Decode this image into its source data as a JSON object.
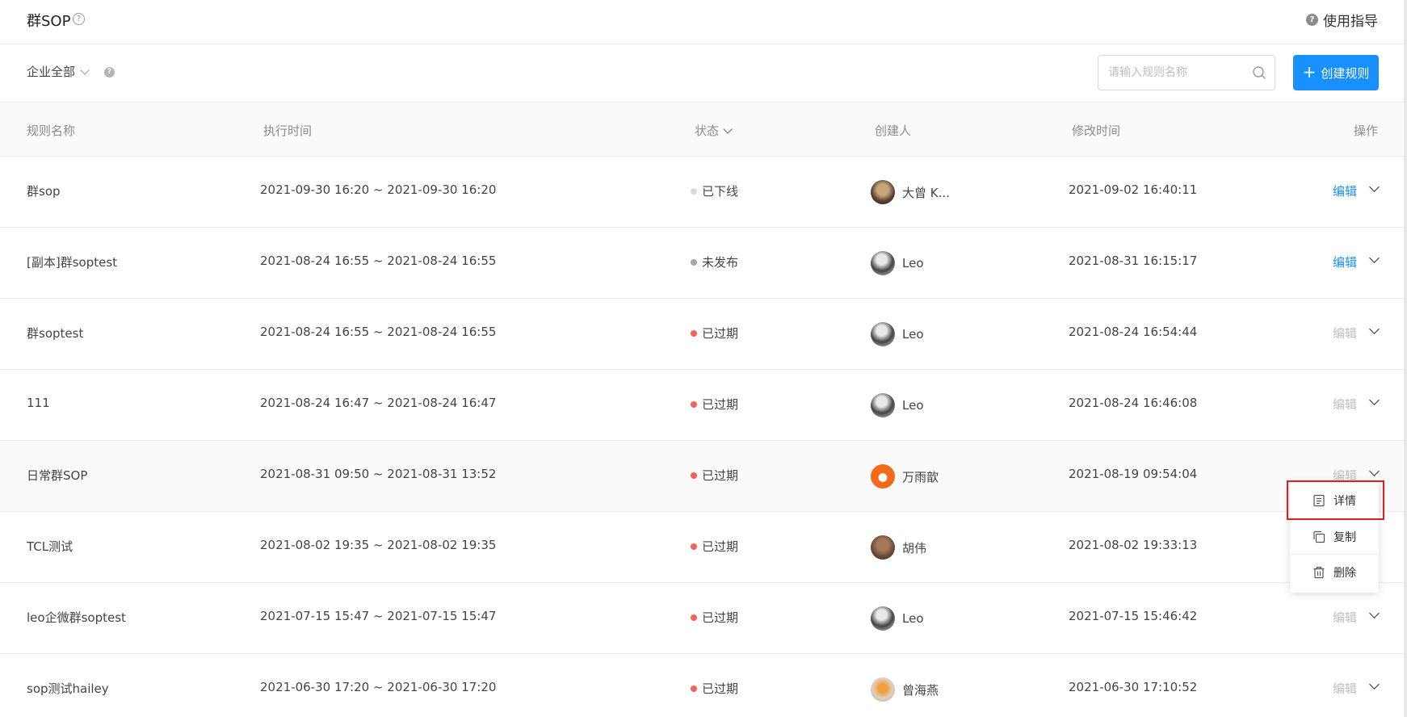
{
  "header": {
    "title": "群SOP",
    "help_glyph": "?",
    "guide_label": "使用指导",
    "guide_glyph": "?"
  },
  "filter": {
    "scope_label": "企业全部",
    "scope_help_glyph": "?",
    "search_placeholder": "请输入规则名称",
    "create_label": "创建规则",
    "create_glyph": "+"
  },
  "table": {
    "columns": {
      "name": "规则名称",
      "time": "执行时间",
      "status": "状态",
      "creator": "创建人",
      "modified": "修改时间",
      "actions": "操作"
    },
    "rows": [
      {
        "name": "群sop",
        "time": "2021-09-30 16:20 ~ 2021-09-30 16:20",
        "status": "已下线",
        "creator": "大曾 K...",
        "modified": "2021-09-02 16:40:11",
        "edit": "编辑"
      },
      {
        "name": "[副本]群soptest",
        "time": "2021-08-24 16:55 ~ 2021-08-24 16:55",
        "status": "未发布",
        "creator": "Leo",
        "modified": "2021-08-31 16:15:17",
        "edit": "编辑"
      },
      {
        "name": "群soptest",
        "time": "2021-08-24 16:55 ~ 2021-08-24 16:55",
        "status": "已过期",
        "creator": "Leo",
        "modified": "2021-08-24 16:54:44",
        "edit": "编辑"
      },
      {
        "name": "111",
        "time": "2021-08-24 16:47 ~ 2021-08-24 16:47",
        "status": "已过期",
        "creator": "Leo",
        "modified": "2021-08-24 16:46:08",
        "edit": "编辑"
      },
      {
        "name": "日常群SOP",
        "time": "2021-08-31 09:50 ~ 2021-08-31 13:52",
        "status": "已过期",
        "creator": "万雨歆",
        "modified": "2021-08-19 09:54:04",
        "edit": "编辑"
      },
      {
        "name": "TCL测试",
        "time": "2021-08-02 19:35 ~ 2021-08-02 19:35",
        "status": "已过期",
        "creator": "胡伟",
        "modified": "2021-08-02 19:33:13",
        "edit": "编辑"
      },
      {
        "name": "leo企微群soptest",
        "time": "2021-07-15 15:47 ~ 2021-07-15 15:47",
        "status": "已过期",
        "creator": "Leo",
        "modified": "2021-07-15 15:46:42",
        "edit": "编辑"
      },
      {
        "name": "sop测试hailey",
        "time": "2021-06-30 17:20 ~ 2021-06-30 17:20",
        "status": "已过期",
        "creator": "曾海燕",
        "modified": "2021-06-30 17:10:52",
        "edit": "编辑"
      }
    ]
  },
  "dropdown_menu": {
    "items": [
      {
        "label": "详情",
        "icon": "document-icon"
      },
      {
        "label": "复制",
        "icon": "copy-icon"
      },
      {
        "label": "删除",
        "icon": "trash-icon"
      }
    ]
  },
  "colors": {
    "primary": "#1890ff",
    "status_offline": "#d9d9d9",
    "status_unpublished": "#a6a6a6",
    "status_expired": "#f5644f",
    "highlight_border": "#e02020"
  }
}
